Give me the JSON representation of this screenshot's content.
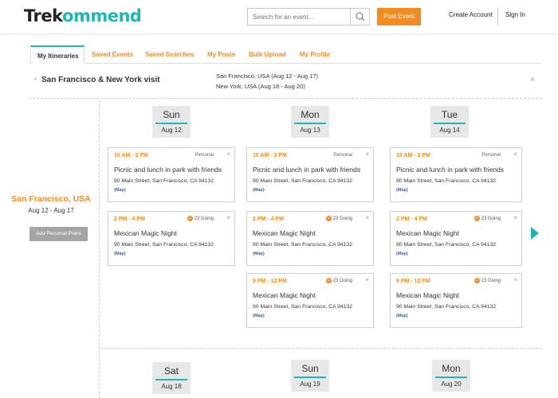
{
  "header": {
    "logo_part1": "Trek",
    "logo_part2": "ommend",
    "search_placeholder": "Search for an event...",
    "post_event_label": "Post Event",
    "create_account_label": "Create Account",
    "sign_in_label": "Sign In"
  },
  "tabs": [
    {
      "label": "My Itineraries",
      "active": true
    },
    {
      "label": "Saved Events",
      "active": false
    },
    {
      "label": "Saved Searches",
      "active": false
    },
    {
      "label": "My Posts",
      "active": false
    },
    {
      "label": "Bulk Upload",
      "active": false
    },
    {
      "label": "My Profile",
      "active": false
    }
  ],
  "trip": {
    "dash": "-",
    "title": "San Francisco & New York visit",
    "legs": [
      "San Francisco, USA (Aug 12 - Aug 17)",
      "New York, USA (Aug 18 - Aug 20)"
    ],
    "close": "×"
  },
  "location": {
    "name": "San Francisco, USA",
    "dates": "Aug 12 - Aug 17",
    "add_label": "Add Personal Plans"
  },
  "days": [
    {
      "name": "Sun",
      "date": "Aug 12"
    },
    {
      "name": "Mon",
      "date": "Aug 13"
    },
    {
      "name": "Tue",
      "date": "Aug 14"
    }
  ],
  "next_days": [
    {
      "name": "Sat",
      "date": "Aug 18"
    },
    {
      "name": "Sun",
      "date": "Aug 19"
    },
    {
      "name": "Mon",
      "date": "Aug 20"
    }
  ],
  "cards": {
    "c0": {
      "time": "10 AM - 2 PM",
      "tag": "Personal",
      "title": "Picnic and lunch in park with friends",
      "address": "90 Main Street, San Francisco, CA 94132",
      "map": "(Map)"
    },
    "c1": {
      "time": "10 AM - 2 PM",
      "tag": "Personal",
      "title": "Picnic and lunch in park with friends",
      "address": "90 Main Street, San Francisco, CA 94132",
      "map": "(Map)"
    },
    "c2": {
      "time": "10 AM - 2 PM",
      "tag": "Personal",
      "title": "Picnic and lunch in park with friends",
      "address": "90 Main Street, San Francisco, CA 94132",
      "map": "(Map)"
    },
    "c3": {
      "time": "2 PM - 4 PM",
      "going": "23 Going",
      "title": "Mexican Magic Night",
      "address": "90 Main Street, San Francisco, CA 94132",
      "map": "(Map)"
    },
    "c4": {
      "time": "2 PM - 4 PM",
      "going": "23 Going",
      "title": "Mexican Magic Night",
      "address": "90 Main Street, San Francisco, CA 94132",
      "map": "(Map)"
    },
    "c5": {
      "time": "2 PM - 4 PM",
      "going": "23 Going",
      "title": "Mexican Magic Night",
      "address": "90 Main Street, San Francisco, CA 94132",
      "map": "(Map)"
    },
    "c6": {
      "time": "9 PM - 12 PM",
      "going": "23 Going",
      "title": "Mexican Magic Night",
      "address": "90 Main Street, San Francisco, CA 94132",
      "map": "(Map)"
    },
    "c7": {
      "time": "9 PM - 12 PM",
      "going": "23 Going",
      "title": "Mexican Magic Night",
      "address": "90 Main Street, San Francisco, CA 94132",
      "map": "(Map)"
    }
  },
  "card_close": "×",
  "going_glyph": "☺",
  "colors": {
    "accent_orange": "#f58a1f",
    "accent_teal": "#1fb6b6",
    "map_link": "#3a5fa8",
    "button_gray": "#a5a5a5"
  },
  "icons": {
    "search": "search-icon",
    "close": "close-icon",
    "next": "triangle-right-icon",
    "going": "people-icon"
  }
}
